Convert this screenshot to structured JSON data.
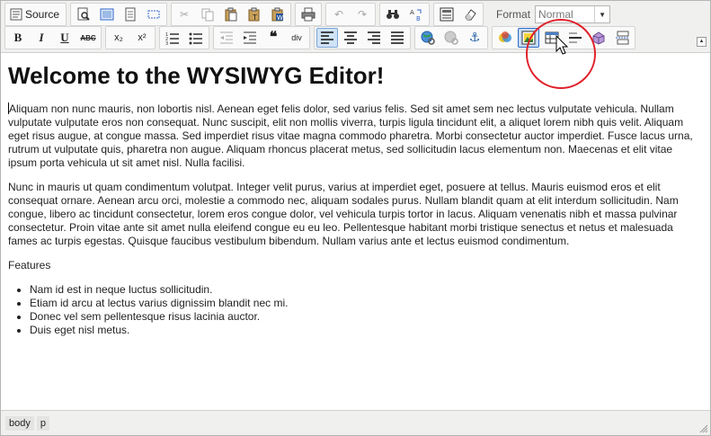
{
  "toolbar": {
    "source_label": "Source",
    "format_label": "Format",
    "format_value": "Normal",
    "row1": [
      {
        "name": "source-icon",
        "glyph": "▤"
      },
      {
        "name": "preview-icon",
        "glyph": "🔍"
      },
      {
        "name": "templates-icon",
        "glyph": "▣"
      },
      {
        "name": "select-all-icon",
        "glyph": "▦"
      },
      {
        "name": "cut-icon",
        "glyph": "✂"
      },
      {
        "name": "copy-icon",
        "glyph": "⧉"
      },
      {
        "name": "paste-icon",
        "glyph": "📋"
      },
      {
        "name": "paste-text-icon",
        "glyph": "📄"
      },
      {
        "name": "paste-word-icon",
        "glyph": "W"
      },
      {
        "name": "print-icon",
        "glyph": "🖶"
      },
      {
        "name": "undo-icon",
        "glyph": "↶"
      },
      {
        "name": "redo-icon",
        "glyph": "↷"
      },
      {
        "name": "find-icon",
        "glyph": "🔭"
      },
      {
        "name": "replace-icon",
        "glyph": "ab"
      },
      {
        "name": "show-blocks-icon",
        "glyph": "▩"
      },
      {
        "name": "remove-format-icon",
        "glyph": "⌫"
      }
    ],
    "row2": {
      "bold": "B",
      "italic": "I",
      "underline": "U",
      "strike": "ABC",
      "subscript": "x₂",
      "superscript": "x²",
      "blockquote": "❝",
      "div": "div"
    }
  },
  "content": {
    "heading": "Welcome to the WYSIWYG Editor!",
    "paragraph1": "Aliquam non nunc mauris, non lobortis nisl. Aenean eget felis dolor, sed varius felis. Sed sit amet sem nec lectus vulputate vehicula. Nullam vulputate vulputate eros non consequat. Nunc suscipit, elit non mollis viverra, turpis ligula tincidunt elit, a aliquet lorem nibh quis velit. Aliquam eget risus augue, at congue massa. Sed imperdiet risus vitae magna commodo pharetra. Morbi consectetur auctor imperdiet. Fusce lacus urna, rutrum ut vulputate quis, pharetra non augue. Aliquam rhoncus placerat metus, sed sollicitudin lacus elementum non. Maecenas et elit vitae ipsum porta vehicula ut sit amet nisl. Nulla facilisi.",
    "paragraph2": "Nunc in mauris ut quam condimentum volutpat. Integer velit purus, varius at imperdiet eget, posuere at tellus. Mauris euismod eros et elit consequat ornare. Aenean arcu orci, molestie a commodo nec, aliquam sodales purus. Nullam blandit quam at elit interdum sollicitudin. Nam congue, libero ac tincidunt consectetur, lorem eros congue dolor, vel vehicula turpis tortor in lacus. Aliquam venenatis nibh et massa pulvinar consectetur. Proin vitae ante sit amet nulla eleifend congue eu eu leo. Pellentesque habitant morbi tristique senectus et netus et malesuada fames ac turpis egestas. Quisque faucibus vestibulum bibendum. Nullam varius ante et lectus euismod condimentum.",
    "features_label": "Features",
    "features": [
      "Nam id est in neque luctus sollicitudin.",
      "Etiam id arcu at lectus varius dignissim blandit nec mi.",
      "Donec vel sem pellentesque risus lacinia auctor.",
      "Duis eget nisl metus."
    ]
  },
  "statusbar": {
    "path": [
      "body",
      "p"
    ]
  },
  "colors": {
    "highlight_ring": "#e0212a",
    "active_button": "#cfe3f7"
  }
}
